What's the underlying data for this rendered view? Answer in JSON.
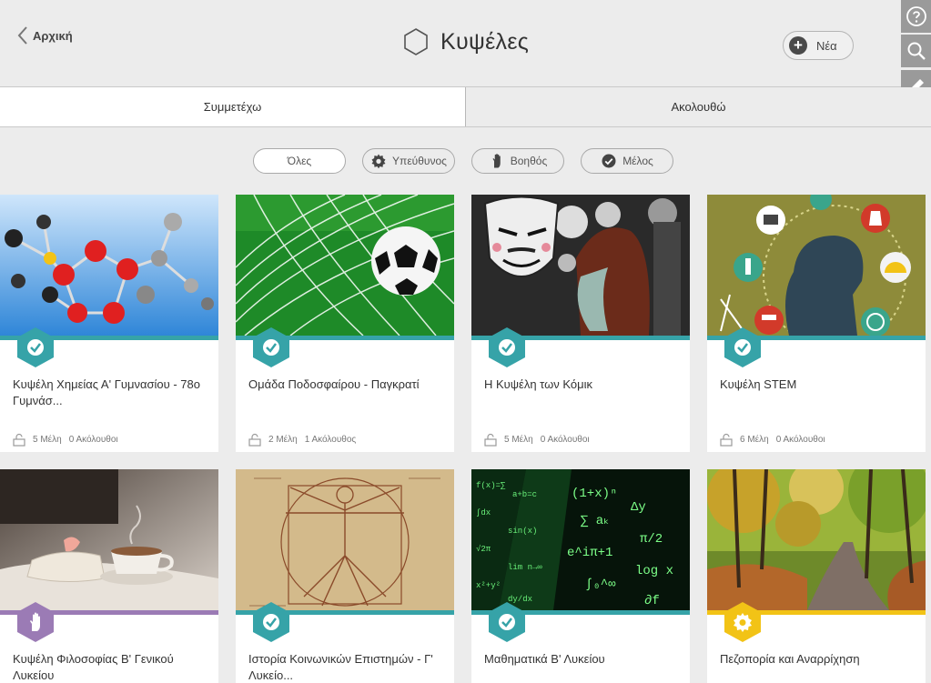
{
  "header": {
    "back_label": "Αρχική",
    "title": "Κυψέλες",
    "new_label": "Νέα"
  },
  "toolbar": {
    "icons": [
      "help-icon",
      "search-icon",
      "pencil-icon"
    ]
  },
  "tabs": [
    {
      "label": "Συμμετέχω",
      "active": true
    },
    {
      "label": "Ακολουθώ",
      "active": false
    }
  ],
  "filters": [
    {
      "label": "Όλες",
      "icon": ""
    },
    {
      "label": "Υπεύθυνος",
      "icon": "gear-icon"
    },
    {
      "label": "Βοηθός",
      "icon": "hand-icon"
    },
    {
      "label": "Μέλος",
      "icon": "check-icon"
    }
  ],
  "colors": {
    "teal": "#36a3a8",
    "purple": "#9b7bb5",
    "yellow": "#f2c316"
  },
  "cards": [
    {
      "name": "Κυψέλη Χημείας Α' Γυμνασίου - 78ο Γυμνάσ...",
      "members": "5 Μέλη",
      "followers": "0 Ακόλουθοι",
      "role": "check-icon",
      "color": "#36a3a8",
      "image": "molecules-image"
    },
    {
      "name": "Ομάδα Ποδοσφαίρου - Παγκρατί",
      "members": "2 Μέλη",
      "followers": "1 Ακόλουθος",
      "role": "check-icon",
      "color": "#36a3a8",
      "image": "football-net-image"
    },
    {
      "name": "Η Κυψέλη των Κόμικ",
      "members": "5 Μέλη",
      "followers": "0 Ακόλουθοι",
      "role": "check-icon",
      "color": "#36a3a8",
      "image": "comic-mask-image"
    },
    {
      "name": "Κυψέλη STEM",
      "members": "6 Μέλη",
      "followers": "0 Ακόλουθοι",
      "role": "check-icon",
      "color": "#36a3a8",
      "image": "stem-thinker-image"
    },
    {
      "name": "Κυψέλη Φιλοσοφίας Β' Γενικού Λυκείου",
      "members": "",
      "followers": "",
      "role": "hand-icon",
      "color": "#9b7bb5",
      "image": "tea-cup-book-image"
    },
    {
      "name": "Ιστορία Κοινωνικών Επιστημών - Γ' Λυκείο...",
      "members": "",
      "followers": "",
      "role": "check-icon",
      "color": "#36a3a8",
      "image": "vitruvian-man-image"
    },
    {
      "name": "Μαθηματικά Β' Λυκείου",
      "members": "",
      "followers": "",
      "role": "check-icon",
      "color": "#36a3a8",
      "image": "math-formulas-image"
    },
    {
      "name": "Πεζοπορία και Αναρρίχηση",
      "members": "",
      "followers": "",
      "role": "gear-icon",
      "color": "#f2c316",
      "image": "forest-path-image"
    }
  ]
}
